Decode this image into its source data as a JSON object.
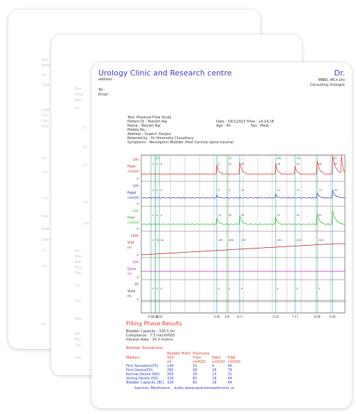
{
  "clinic": {
    "name": "Urology Clinic and Research centre",
    "address_label": "address :",
    "tel_label": "Tel :",
    "email_label": "Email :",
    "doctor": "Dr.",
    "degree": "MBBS, MCh Uro",
    "role": "Consulting Urologist"
  },
  "patient": {
    "test": "Test: Pressure Flow Study",
    "patient_id": "Patient ID : Teerath Raj",
    "name": "Name : Teerath Raj",
    "mobile": "Mobile No.:",
    "address": "Address : Gujaini ,Kanpur",
    "referred_by": "Referred by : Dr Himanshu Choudhary",
    "symptoms": "Symptoms : Neurogenic Bladder (Post Cervical spine trauma)",
    "date": "Date : 19\\1\\2013 Time : 14:14:18",
    "age": "Age : 45",
    "sex": "Sex : Male"
  },
  "chart_data": {
    "type": "line",
    "channels": [
      {
        "name": "Pves",
        "unit": "cmH2O",
        "scale_top": "100",
        "color": "#e02020",
        "values": [
          "0",
          "0",
          "0",
          "0",
          "32",
          "44",
          "28",
          "44",
          "48",
          "36"
        ]
      },
      {
        "name": "Pabd",
        "unit": "cmH2O",
        "scale_top": "100",
        "color": "#2030c8",
        "values": [
          "0",
          "0",
          "0",
          "9",
          "4",
          "15",
          "20",
          "13",
          "13",
          "16"
        ]
      },
      {
        "name": "Pdet",
        "unit": "cmH2O",
        "scale_top": "100",
        "color": "#20b020",
        "values": [
          "0",
          "0",
          "0",
          "21",
          "32",
          "30",
          "22",
          "42",
          "32"
        ]
      },
      {
        "name": "Vinf",
        "unit": "ml",
        "scale_top": "1000",
        "color": "#c02020",
        "values": [
          "0",
          "32",
          "44",
          "169",
          "186",
          "239",
          "282",
          "305",
          "326"
        ]
      },
      {
        "name": "Qura",
        "unit": "ml",
        "scale_top": "500",
        "color": "#c020c0",
        "values": []
      },
      {
        "name": "Vura",
        "unit": "ml",
        "scale_top": "25",
        "color": "#333333",
        "values": [
          "0",
          "0",
          "0",
          "0",
          "0",
          "0",
          "0",
          "0",
          "0"
        ]
      }
    ],
    "markers": [
      "VU",
      "SC",
      "ND",
      "SD",
      "BC"
    ],
    "time_labels": [
      "0:11",
      "0:30",
      "0:44",
      "3:26",
      "4:6",
      "4:17",
      "5:42",
      "7:17",
      "8:28",
      "9:30"
    ]
  },
  "filling": {
    "title": "Filling Phase Results",
    "capacity": "Bladder Capacity : 326.5 ml",
    "compliance": "Compliance : 7.5 ml/cmH2O",
    "infusion": "Infusion Rate : 34.3 ml/min"
  },
  "sensations": {
    "title": "Bladder Sensations",
    "header1": [
      "",
      "Bladder filled",
      "Pressures",
      "",
      ""
    ],
    "header2": [
      "Markers",
      "Vinf",
      "Pves",
      "Pabd",
      "Pdet"
    ],
    "header3": [
      "",
      "ml",
      "cmH2O",
      "cmH2O",
      "cmH2O"
    ],
    "rows": [
      [
        "First Sensation(FS)",
        "190",
        "52",
        "6",
        "46"
      ],
      [
        "First Desire(FD)",
        "282",
        "95",
        "16",
        "79"
      ],
      [
        "Normal Desire (ND)",
        "305",
        "35",
        "13",
        "21"
      ],
      [
        "Strong Desire (SD)",
        "326",
        "82",
        "18",
        "64"
      ],
      [
        "Bladder Capacity (BC)",
        "326",
        "82",
        "18",
        "64"
      ]
    ]
  },
  "footer": "Santron Meditronic , India  www.santronmeditronic.in"
}
